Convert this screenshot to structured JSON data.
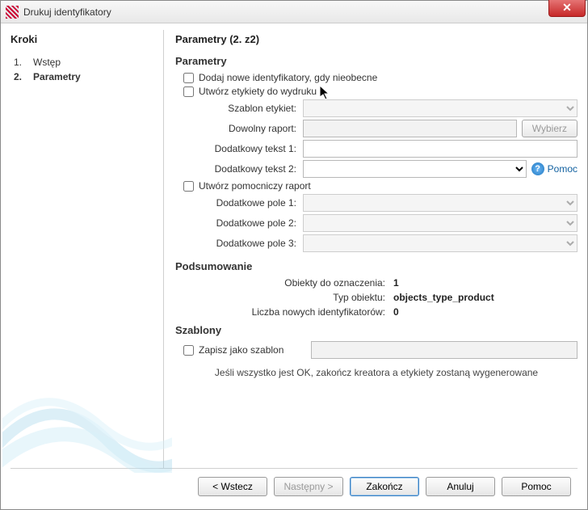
{
  "window": {
    "title": "Drukuj identyfikatory"
  },
  "sidebar": {
    "heading": "Kroki",
    "steps": [
      {
        "num": "1.",
        "label": "Wstęp"
      },
      {
        "num": "2.",
        "label": "Parametry"
      }
    ]
  },
  "main": {
    "heading": "Parametry (2. z2)",
    "params": {
      "title": "Parametry",
      "chk_add_ids": "Dodaj nowe identyfikatory, gdy nieobecne",
      "chk_make_labels": "Utwórz etykiety do wydruku",
      "label_template": "Szablon etykiet:",
      "any_report": "Dowolny raport:",
      "choose_btn": "Wybierz",
      "extra_text1": "Dodatkowy tekst 1:",
      "extra_text2": "Dodatkowy tekst 2:",
      "help": "Pomoc",
      "chk_aux_report": "Utwórz pomocniczy raport",
      "extra_field1": "Dodatkowe pole 1:",
      "extra_field2": "Dodatkowe pole 2:",
      "extra_field3": "Dodatkowe pole 3:"
    },
    "summary": {
      "title": "Podsumowanie",
      "objects_label": "Obiekty do oznaczenia:",
      "objects_value": "1",
      "type_label": "Typ obiektu:",
      "type_value": "objects_type_product",
      "new_ids_label": "Liczba nowych identyfikatorów:",
      "new_ids_value": "0"
    },
    "templates": {
      "title": "Szablony",
      "chk_save": "Zapisz jako szablon"
    },
    "note": "Jeśli wszystko jest OK, zakończ kreatora a etykiety zostaną wygenerowane"
  },
  "footer": {
    "back": "< Wstecz",
    "next": "Następny >",
    "finish": "Zakończ",
    "cancel": "Anuluj",
    "help": "Pomoc"
  }
}
